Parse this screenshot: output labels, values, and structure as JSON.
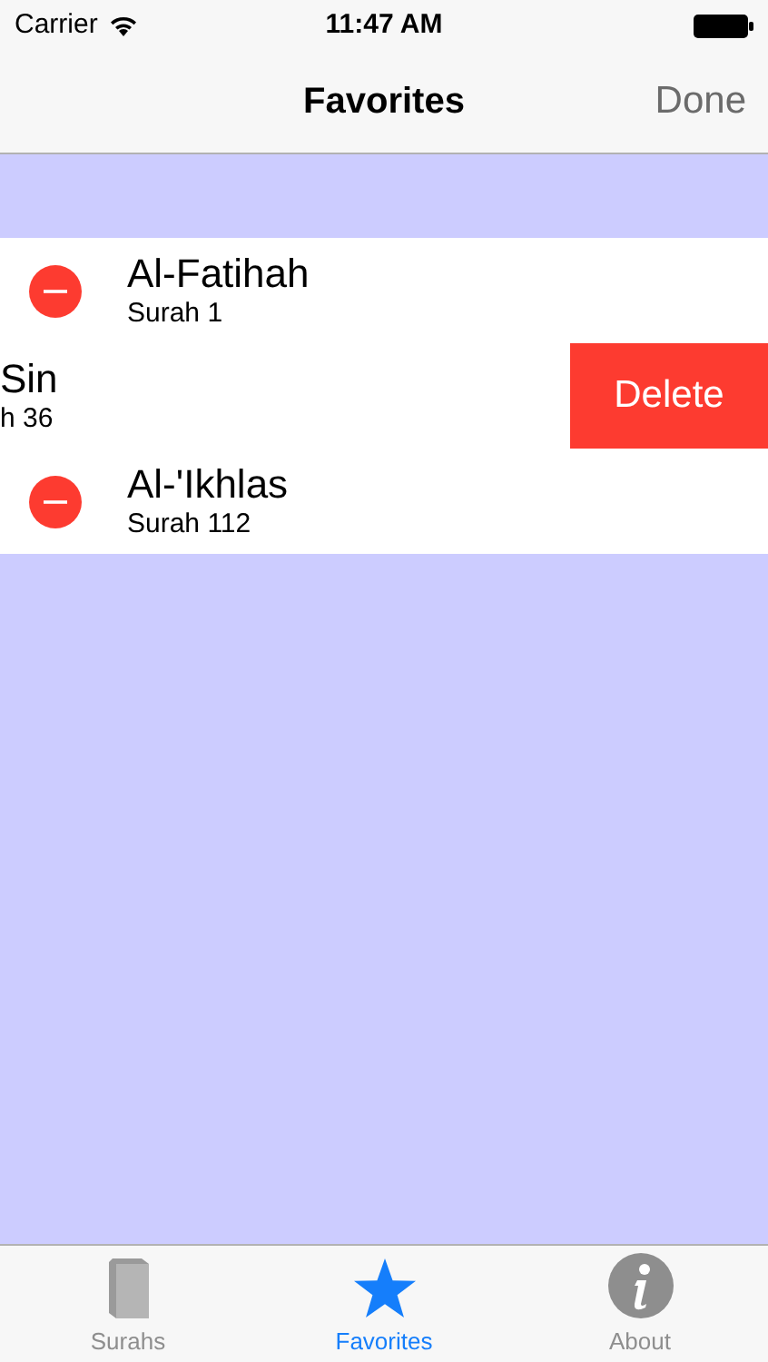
{
  "status_bar": {
    "carrier": "Carrier",
    "time": "11:47 AM"
  },
  "nav_bar": {
    "title": "Favorites",
    "done": "Done"
  },
  "rows": [
    {
      "title": "Al-Fatihah",
      "subtitle": "Surah 1",
      "swiped": false
    },
    {
      "title": "Sin",
      "subtitle": "h 36",
      "swiped": true,
      "action": "Delete"
    },
    {
      "title": "Al-'Ikhlas",
      "subtitle": "Surah 112",
      "swiped": false
    }
  ],
  "tabs": [
    {
      "label": "Surahs",
      "kind": "book",
      "selected": false
    },
    {
      "label": "Favorites",
      "kind": "star",
      "selected": true
    },
    {
      "label": "About",
      "kind": "info",
      "selected": false
    }
  ]
}
